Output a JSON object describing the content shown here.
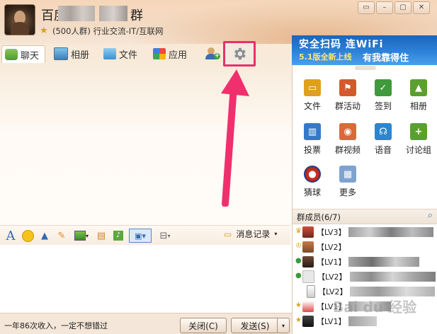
{
  "window": {
    "group_name_prefix": "百度",
    "group_name_suffix": "群",
    "group_info": "(500人群) 行业交流-IT/互联网",
    "controls": [
      "▭",
      "–",
      "▢",
      "✕"
    ]
  },
  "tabs": [
    {
      "label": "聊天",
      "icon": "chat-icon"
    },
    {
      "label": "相册",
      "icon": "album-icon"
    },
    {
      "label": "文件",
      "icon": "folder-icon"
    },
    {
      "label": "应用",
      "icon": "apps-icon"
    }
  ],
  "banner": {
    "line1": "安全扫码 连WiFi",
    "line2a": "5.1版全新上线",
    "line2b": "有我靠得住"
  },
  "apps": [
    {
      "label": "文件",
      "color": "#e0a01c",
      "icon": "folder-icon",
      "glyph": "▭"
    },
    {
      "label": "群活动",
      "color": "#d25a2b",
      "icon": "flag-icon",
      "glyph": "⚑"
    },
    {
      "label": "签到",
      "color": "#3e9a3a",
      "icon": "checkin-icon",
      "glyph": "✓"
    },
    {
      "label": "相册",
      "color": "#5aa02f",
      "icon": "photo-icon",
      "glyph": "▲"
    },
    {
      "label": "投票",
      "color": "#3379c9",
      "icon": "vote-icon",
      "glyph": "▥"
    },
    {
      "label": "群视频",
      "color": "#d9683a",
      "icon": "video-icon",
      "glyph": "◉"
    },
    {
      "label": "语音",
      "color": "#2c86cf",
      "icon": "voice-icon",
      "glyph": "☊"
    },
    {
      "label": "讨论组",
      "color": "#5aa02f",
      "icon": "discussion-icon",
      "glyph": "+"
    },
    {
      "label": "猜球",
      "color": "#c8322b",
      "icon": "ball-icon",
      "glyph": "●"
    },
    {
      "label": "更多",
      "color": "#7fa3cf",
      "icon": "more-icon",
      "glyph": "▦"
    }
  ],
  "members": {
    "title": "群成员(6/7)",
    "list": [
      {
        "level": "【LV3】",
        "role": "owner"
      },
      {
        "level": "【LV2】",
        "role": "admin"
      },
      {
        "level": "【LV1】",
        "role": "member"
      },
      {
        "level": "【LV2】",
        "role": "member"
      },
      {
        "level": "【LV2】",
        "role": "member"
      },
      {
        "level": "【LV1】",
        "role": "admin"
      },
      {
        "level": "【LV1】",
        "role": "admin"
      }
    ]
  },
  "toolbar": {
    "message_record": "消息记录"
  },
  "bottom": {
    "tip": "一年86次收入，一定不想错过",
    "close_label": "关闭(C)",
    "send_label": "发送(S)"
  },
  "watermark": "Bai du 经验"
}
